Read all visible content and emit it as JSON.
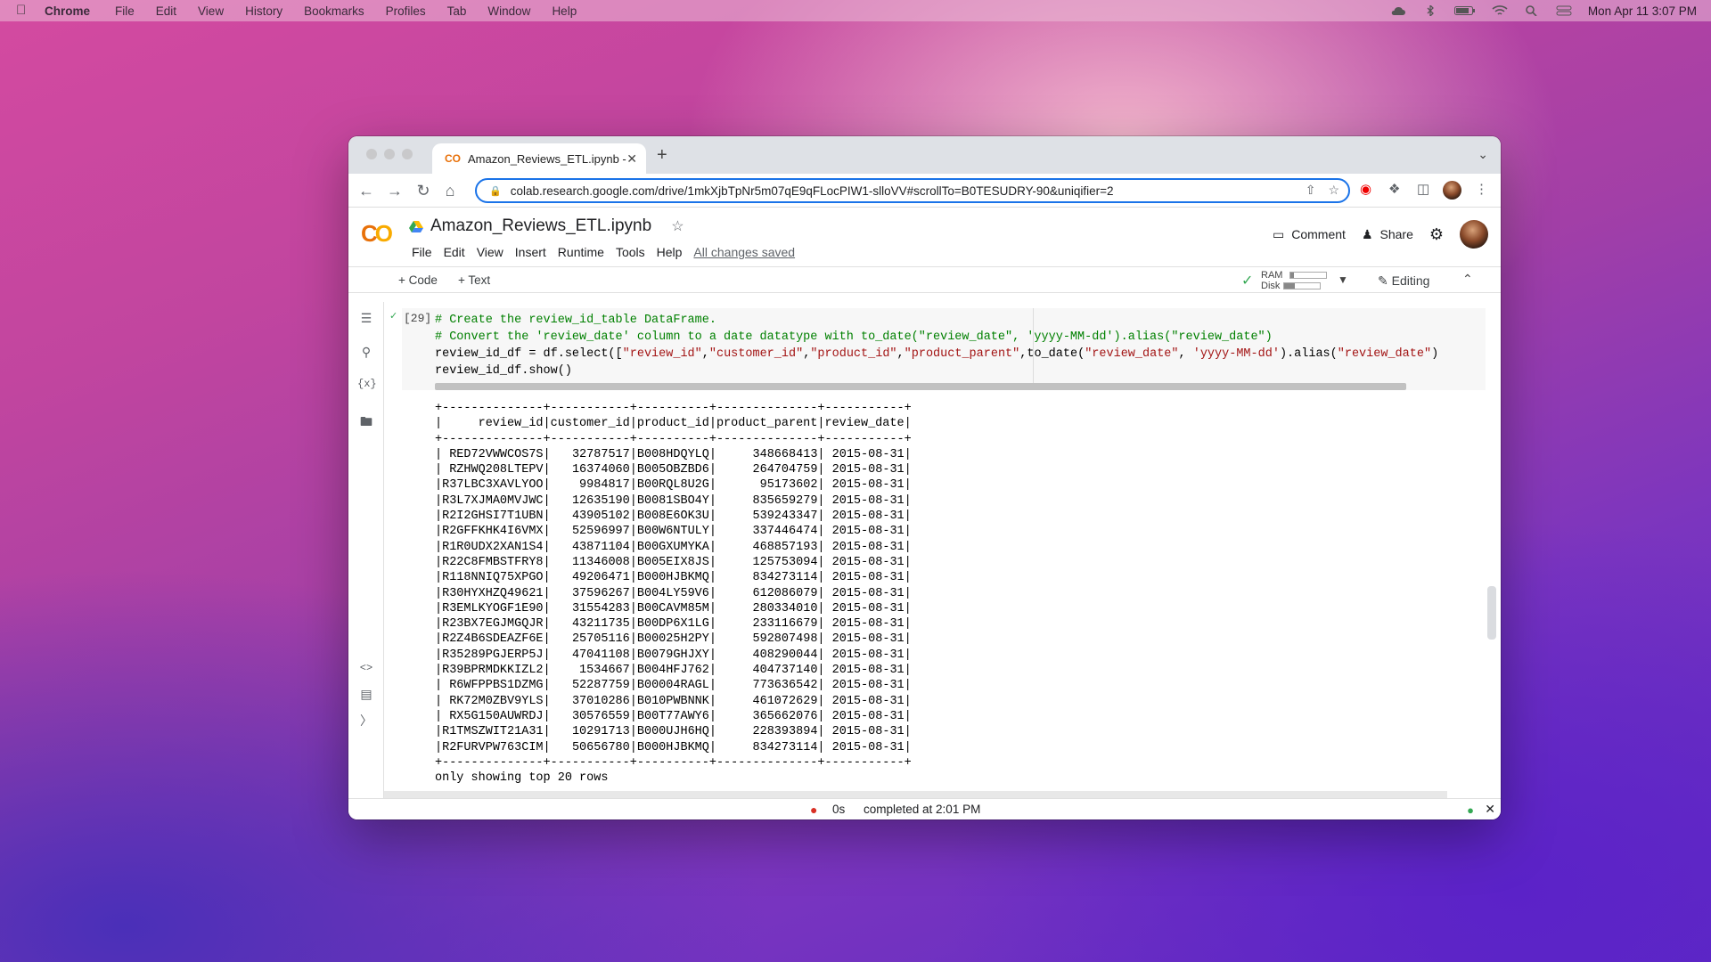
{
  "menubar": {
    "app": "Chrome",
    "items": [
      "File",
      "Edit",
      "View",
      "History",
      "Bookmarks",
      "Profiles",
      "Tab",
      "Window",
      "Help"
    ],
    "datetime": "Mon Apr 11  3:07 PM"
  },
  "browser": {
    "tab_title": "Amazon_Reviews_ETL.ipynb -",
    "url": "colab.research.google.com/drive/1mkXjbTpNr5m07qE9qFLocPIW1-slloVV#scrollTo=B0TESUDRY-90&uniqifier=2"
  },
  "colab": {
    "notebook_title": "Amazon_Reviews_ETL.ipynb",
    "menus": [
      "File",
      "Edit",
      "View",
      "Insert",
      "Runtime",
      "Tools",
      "Help"
    ],
    "save_status": "All changes saved",
    "comment_label": "Comment",
    "share_label": "Share",
    "add_code": "+ Code",
    "add_text": "+ Text",
    "ram_label": "RAM",
    "disk_label": "Disk",
    "ram_usage": 0.08,
    "disk_usage": 0.3,
    "editing_label": "Editing"
  },
  "cell": {
    "exec_count": "[29]",
    "code_lines": [
      [
        {
          "t": "# Create the review_id_table DataFrame.",
          "c": "cm"
        }
      ],
      [
        {
          "t": "# Convert the 'review_date' column to a date datatype with to_date(\"review_date\", 'yyyy-MM-dd').alias(\"review_date\")",
          "c": "cm"
        }
      ],
      [
        {
          "t": "review_id_df = df.select([",
          "c": ""
        },
        {
          "t": "\"review_id\"",
          "c": "st"
        },
        {
          "t": ",",
          "c": ""
        },
        {
          "t": "\"customer_id\"",
          "c": "st"
        },
        {
          "t": ",",
          "c": ""
        },
        {
          "t": "\"product_id\"",
          "c": "st"
        },
        {
          "t": ",",
          "c": ""
        },
        {
          "t": "\"product_parent\"",
          "c": "st"
        },
        {
          "t": ",to_date(",
          "c": ""
        },
        {
          "t": "\"review_date\"",
          "c": "st"
        },
        {
          "t": ", ",
          "c": ""
        },
        {
          "t": "'yyyy-MM-dd'",
          "c": "st"
        },
        {
          "t": ").alias(",
          "c": ""
        },
        {
          "t": "\"review_date\"",
          "c": "st"
        },
        {
          "t": ")",
          "c": ""
        }
      ],
      [
        {
          "t": "review_id_df.show()",
          "c": ""
        }
      ]
    ]
  },
  "output": {
    "border": "+--------------+-----------+----------+--------------+-----------+",
    "header": "|     review_id|customer_id|product_id|product_parent|review_date|",
    "rows": [
      [
        "RED72VWWCOS7S",
        "32787517",
        "B008HDQYLQ",
        "348668413",
        "2015-08-31"
      ],
      [
        "RZHWQ208LTEPV",
        "16374060",
        "B005OBZBD6",
        "264704759",
        "2015-08-31"
      ],
      [
        "R37LBC3XAVLYOO",
        "9984817",
        "B00RQL8U2G",
        "95173602",
        "2015-08-31"
      ],
      [
        "R3L7XJMA0MVJWC",
        "12635190",
        "B0081SBO4Y",
        "835659279",
        "2015-08-31"
      ],
      [
        "R2I2GHSI7T1UBN",
        "43905102",
        "B008E6OK3U",
        "539243347",
        "2015-08-31"
      ],
      [
        "R2GFFKHK4I6VMX",
        "52596997",
        "B00W6NTULY",
        "337446474",
        "2015-08-31"
      ],
      [
        "R1R0UDX2XAN1S4",
        "43871104",
        "B00GXUMYKA",
        "468857193",
        "2015-08-31"
      ],
      [
        "R22C8FMBSTFRY8",
        "11346008",
        "B005EIX8JS",
        "125753094",
        "2015-08-31"
      ],
      [
        "R118NNIQ75XPGO",
        "49206471",
        "B000HJBKMQ",
        "834273114",
        "2015-08-31"
      ],
      [
        "R30HYXHZQ49621",
        "37596267",
        "B004LY59V6",
        "612086079",
        "2015-08-31"
      ],
      [
        "R3EMLKYOGF1E90",
        "31554283",
        "B00CAVM85M",
        "280334010",
        "2015-08-31"
      ],
      [
        "R23BX7EGJMGQJR",
        "43211735",
        "B00DP6X1LG",
        "233116679",
        "2015-08-31"
      ],
      [
        "R2Z4B6SDEAZF6E",
        "25705116",
        "B00025H2PY",
        "592807498",
        "2015-08-31"
      ],
      [
        "R35289PGJERP5J",
        "47041108",
        "B0079GHJXY",
        "408290044",
        "2015-08-31"
      ],
      [
        "R39BPRMDKKIZL2",
        "1534667",
        "B004HFJ762",
        "404737140",
        "2015-08-31"
      ],
      [
        "R6WFPPBS1DZMG",
        "52287759",
        "B00004RAGL",
        "773636542",
        "2015-08-31"
      ],
      [
        "RK72M0ZBV9YLS",
        "37010286",
        "B010PWBNNK",
        "461072629",
        "2015-08-31"
      ],
      [
        "RX5G150AUWRDJ",
        "30576559",
        "B00T77AWY6",
        "365662076",
        "2015-08-31"
      ],
      [
        "R1TMSZWIT21A31",
        "10291713",
        "B000UJH6HQ",
        "228393894",
        "2015-08-31"
      ],
      [
        "R2FURVPW763CIM",
        "50656780",
        "B000HJBKMQ",
        "834273114",
        "2015-08-31"
      ]
    ],
    "footer": "only showing top 20 rows"
  },
  "statusbar": {
    "elapsed": "0s",
    "message": "completed at 2:01 PM"
  },
  "colors": {
    "accent": "#1a73e8",
    "colab_orange": "#e8710a",
    "colab_yellow": "#f9ab00",
    "comment_green": "#008000",
    "string_red": "#a31515",
    "ok_green": "#34a853",
    "error_red": "#d93025"
  }
}
